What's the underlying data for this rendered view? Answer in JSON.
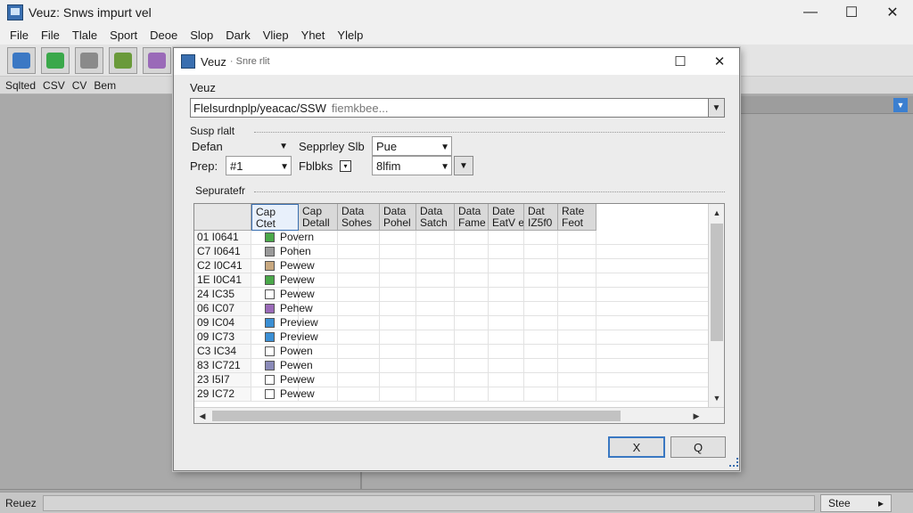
{
  "app": {
    "title": "Veuz: Snws impurt vel",
    "controls": {
      "minimize": "—",
      "maximize": "☐",
      "close": "✕"
    }
  },
  "menu": [
    "File",
    "File",
    "Tlale",
    "Sport",
    "Deoe",
    "Slop",
    "Dark",
    "Vliep",
    "Yhet",
    "Ylelp"
  ],
  "toolbar": {
    "buttons": [
      {
        "icon": "monitor-icon",
        "color": "#3b78c4"
      },
      {
        "icon": "edit-icon",
        "color": "#3aa84a"
      },
      {
        "icon": "network-icon",
        "color": "#8a8a8a"
      },
      {
        "icon": "tools-icon",
        "color": "#6a9a3a"
      },
      {
        "icon": "palette-icon",
        "color": "#9a6ab8"
      }
    ]
  },
  "subbar": {
    "items": [
      "Sqlted",
      "CSV",
      "CV",
      "Bem"
    ]
  },
  "statusbar": {
    "left": "Reuez",
    "right_label": "Stee",
    "right_arrow": "▸"
  },
  "dialog": {
    "title": "Veuz",
    "subtitle": "· Snre rlit",
    "controls": {
      "maximize": "☐",
      "close": "✕"
    },
    "file_label": "Veuz",
    "file_path": "Flelsurdnplp/yeacac/SSW",
    "file_placeholder": "fiemkbee...",
    "group_label": "Susp rlalt",
    "delimiter_label": "Defan",
    "delimiter_arrow": "▼",
    "row_label": "Prep:",
    "row_value": "#1",
    "row_arrow": "▼",
    "separator_label": "Sepprley Slb",
    "separator_value": "Pue",
    "separator_arrow": "▼",
    "fields_label": "Fblbks",
    "fields_checkbox": "▾",
    "format_value": "8lfim",
    "format_arrow": "▼",
    "extra_arrow": "▼",
    "preview_label": "Sepuratefr",
    "columns": [
      "Cap\nCtet",
      "Cap\nDetall",
      "Data\nSohes",
      "Data\nPohel",
      "Data\nSatch",
      "Data\nFame k",
      "Date\nEatV e",
      "Dat\nIZ5f0",
      "Rate\nFeot"
    ],
    "rows": [
      {
        "id": "01 I0641",
        "icon": "#4aa84a",
        "preview": "Povern"
      },
      {
        "id": "C7 I0641",
        "icon": "#9a9a9a",
        "preview": "Pohen"
      },
      {
        "id": "C2 I0C41",
        "icon": "#c8a880",
        "preview": "Pewew"
      },
      {
        "id": "1E I0C41",
        "icon": "#4aa84a",
        "preview": "Pewew"
      },
      {
        "id": "24 IC35",
        "icon": "#ffffff",
        "preview": "Pewew"
      },
      {
        "id": "06 IC07",
        "icon": "#9a6ab8",
        "preview": "Pehew"
      },
      {
        "id": "09 IC04",
        "icon": "#3b8fd4",
        "preview": "Preview"
      },
      {
        "id": "09 IC73",
        "icon": "#3b8fd4",
        "preview": "Preview"
      },
      {
        "id": "C3 IC34",
        "icon": "#ffffff",
        "preview": "Powen"
      },
      {
        "id": "83 IC721",
        "icon": "#8a8ab8",
        "preview": "Pewen"
      },
      {
        "id": "23 I5I7",
        "icon": "#ffffff",
        "preview": "Pewew"
      },
      {
        "id": "29 IC72",
        "icon": "#ffffff",
        "preview": "Pewew"
      }
    ],
    "ok_button": "X",
    "cancel_button": "Q",
    "scroll_up": "▲",
    "scroll_down": "▼",
    "scroll_left": "◀",
    "scroll_right": "▶"
  }
}
